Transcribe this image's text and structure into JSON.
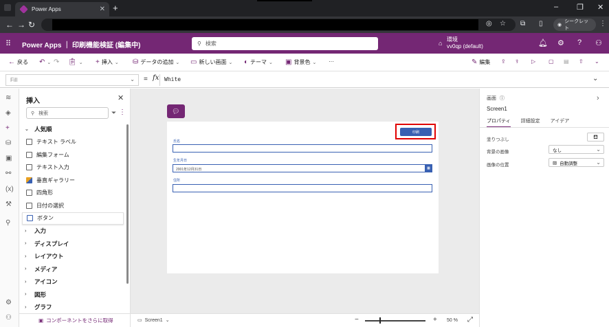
{
  "browser": {
    "tab_title": "Power Apps",
    "tab_close": "✕",
    "new_tab": "+",
    "incognito_label": "シークレット"
  },
  "header": {
    "app_title": "Power Apps ｜ 印刷機能検証 (編集中)",
    "search_placeholder": "検索",
    "env_label": "環境",
    "env_name": "vv0qp (default)"
  },
  "commandbar": {
    "back": "戻る",
    "insert": "挿入",
    "add_data": "データの追加",
    "new_screen": "新しい画面",
    "theme": "テーマ",
    "background": "背景色",
    "more": "···",
    "edit": "編集"
  },
  "formula": {
    "property": "Fill",
    "equals": "=",
    "fx": "fx",
    "value": "White"
  },
  "insert_pane": {
    "title": "挿入",
    "search_placeholder": "検索",
    "popular_group": "人気順",
    "popular_items": [
      {
        "label": "テキスト ラベル",
        "icon": "text-label-icon"
      },
      {
        "label": "編集フォーム",
        "icon": "edit-form-icon"
      },
      {
        "label": "テキスト入力",
        "icon": "text-input-icon"
      },
      {
        "label": "垂直ギャラリー",
        "icon": "gallery-icon"
      },
      {
        "label": "四角形",
        "icon": "rectangle-icon"
      },
      {
        "label": "日付の選択",
        "icon": "date-picker-icon"
      },
      {
        "label": "ボタン",
        "icon": "button-icon"
      }
    ],
    "groups": [
      "入力",
      "ディスプレイ",
      "レイアウト",
      "メディア",
      "アイコン",
      "図形",
      "グラフ"
    ],
    "footer_link": "コンポーネントをさらに取得"
  },
  "canvas": {
    "print_button": "印刷",
    "field1_label": "氏名",
    "field2_label": "生年月日",
    "field2_value": "2001年12月31日",
    "field3_label": "住所",
    "calendar_glyph": "▦"
  },
  "statusbar": {
    "screen_tab": "Screen1",
    "zoom": "50 %"
  },
  "properties": {
    "section_title": "画面",
    "control_name": "Screen1",
    "tabs": [
      "プロパティ",
      "詳細設定",
      "アイデア"
    ],
    "fill_label": "塗りつぶし",
    "bg_image_label": "背景の画像",
    "bg_image_value": "なし",
    "image_position_label": "画像の位置",
    "image_position_value": "自動調整"
  },
  "colors": {
    "brand": "#742774",
    "canvas_control": "#3860b2",
    "highlight": "#e00000"
  }
}
